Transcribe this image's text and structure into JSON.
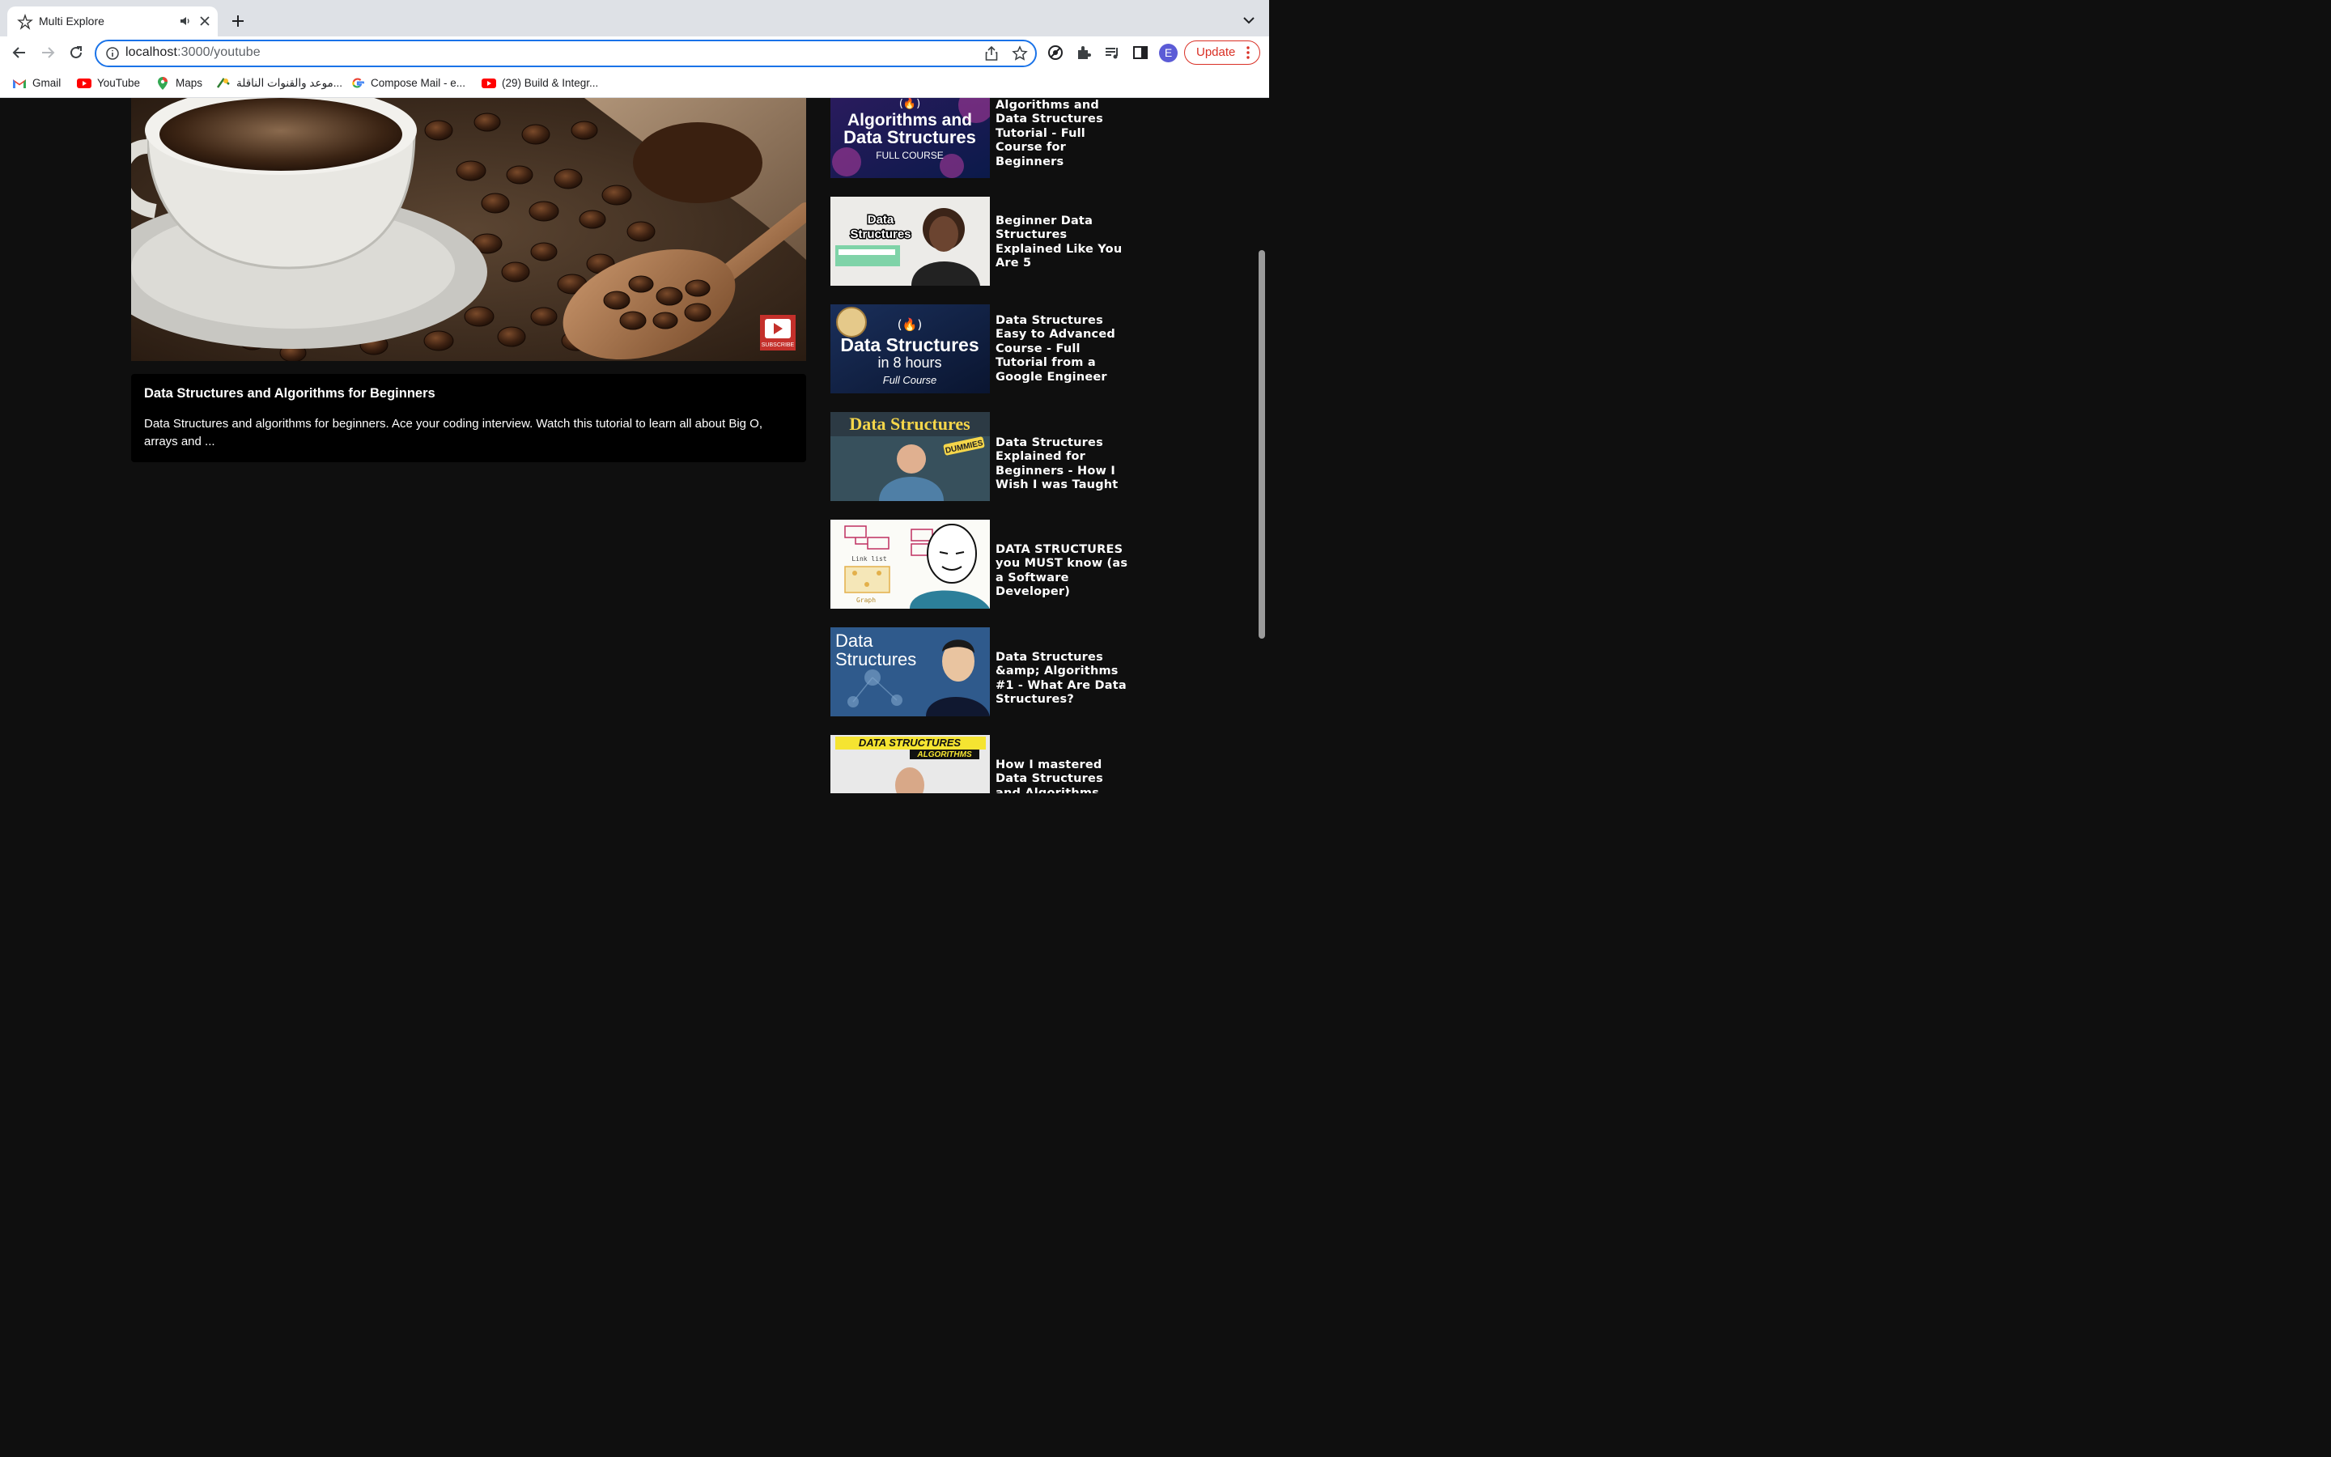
{
  "browser": {
    "tab": {
      "title": "Multi Explore",
      "audio_icon": "speaker-icon",
      "close_icon": "close-icon"
    },
    "new_tab_icon": "plus-icon",
    "address": {
      "host": "localhost",
      "path": ":3000/youtube"
    },
    "profile_initial": "E",
    "update_label": "Update",
    "bookmarks": [
      {
        "label": "Gmail",
        "icon": "gmail-icon"
      },
      {
        "label": "YouTube",
        "icon": "youtube-icon"
      },
      {
        "label": "Maps",
        "icon": "maps-icon"
      },
      {
        "label": "موعد والقنوات الناقلة...",
        "icon": "football-icon"
      },
      {
        "label": "Compose Mail - e...",
        "icon": "google-icon"
      },
      {
        "label": "(29) Build & Integr...",
        "icon": "youtube-icon"
      }
    ]
  },
  "main_video": {
    "subscribe_label": "SUBSCRIBE",
    "title": "Data Structures and Algorithms for Beginners",
    "description": "Data Structures and algorithms for beginners. Ace your coding interview. Watch this tutorial to learn all about Big O, arrays and ..."
  },
  "sidebar": {
    "videos": [
      {
        "title": "Algorithms and Data Structures Tutorial - Full Course for Beginners",
        "thumb_text": [
          "Algorithms and",
          "Data Structures",
          "FULL COURSE"
        ]
      },
      {
        "title": "Beginner Data Structures Explained Like You Are 5",
        "thumb_text": [
          "Data",
          "Structures"
        ]
      },
      {
        "title": "Data Structures Easy to Advanced Course - Full Tutorial from a Google Engineer",
        "thumb_text": [
          "Data Structures",
          "in 8 hours",
          "Full Course"
        ]
      },
      {
        "title": "Data Structures Explained for Beginners - How I Wish I was Taught",
        "thumb_text": [
          "Data Structures",
          "DUMMIES"
        ]
      },
      {
        "title": "DATA STRUCTURES you MUST know (as a Software Developer)",
        "thumb_text": [
          "Link list",
          "Graph"
        ]
      },
      {
        "title": "Data Structures &amp; Algorithms #1 - What Are Data Structures?",
        "thumb_text": [
          "Data",
          "Structures"
        ]
      },
      {
        "title": "How I mastered Data Structures and Algorithms",
        "thumb_text": [
          "DATA STRUCTURES",
          "ALGORITHMS"
        ]
      }
    ]
  }
}
